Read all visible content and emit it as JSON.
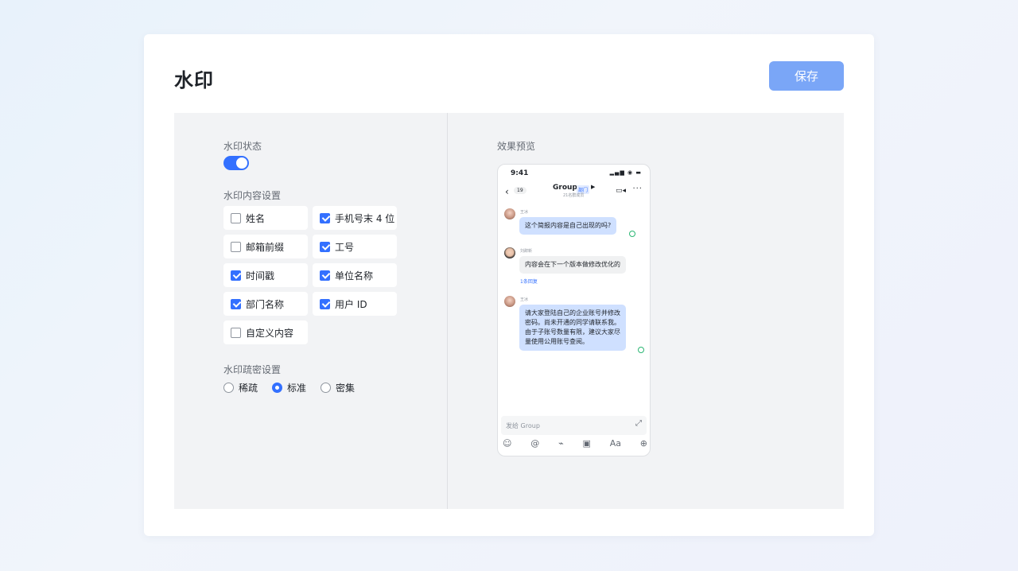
{
  "page": {
    "title": "水印",
    "save_label": "保存"
  },
  "settings": {
    "status_label": "水印状态",
    "status_on": true,
    "content_label": "水印内容设置",
    "options": [
      {
        "label": "姓名",
        "checked": false
      },
      {
        "label": "手机号末 4 位",
        "checked": true
      },
      {
        "label": "邮箱前缀",
        "checked": false
      },
      {
        "label": "工号",
        "checked": true
      },
      {
        "label": "时间戳",
        "checked": true
      },
      {
        "label": "单位名称",
        "checked": true
      },
      {
        "label": "部门名称",
        "checked": true
      },
      {
        "label": "用户 ID",
        "checked": true
      },
      {
        "label": "自定义内容",
        "checked": false
      }
    ],
    "density_label": "水印疏密设置",
    "density_options": [
      "稀疏",
      "标准",
      "密集"
    ],
    "density_selected": "标准"
  },
  "preview": {
    "label": "效果预览",
    "status_time": "9:41",
    "back_count": "19",
    "group_name": "Group",
    "group_tag": "部门",
    "group_sub": "21名群成员",
    "messages": [
      {
        "sender": "王冰",
        "text": "这个简报内容是自己出现的吗?"
      },
      {
        "sender": "刘辞新",
        "text": "内容会在下一个版本做修改优化的"
      },
      {
        "sender": "王冰",
        "lines": [
          "请大家登陆自己的企业账号并修改",
          "密码。尚未开通的同学请联系我。",
          "由于子账号数量有限，建议大家尽",
          "量使用公用账号查阅。"
        ]
      }
    ],
    "reply_link": "1条回复",
    "input_placeholder": "发给 Group"
  },
  "colors": {
    "accent": "#3370ff",
    "save_button": "#7aa6f7",
    "bubble_blue": "#cfe0ff"
  }
}
